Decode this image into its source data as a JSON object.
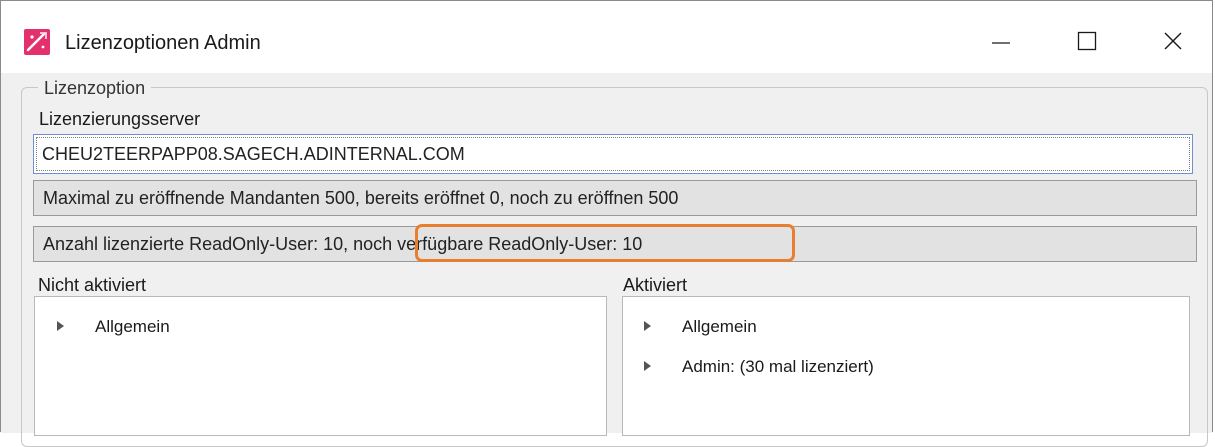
{
  "window": {
    "title": "Lizenzoptionen Admin",
    "controls": {
      "minimize": "—",
      "maximize": "☐",
      "close": "✕"
    }
  },
  "group": {
    "legend": "Lizenzoption"
  },
  "server": {
    "label": "Lizenzierungsserver",
    "value": "CHEU2TEERPAPP08.SAGECH.ADINTERNAL.COM"
  },
  "info": {
    "mandanten": "Maximal zu eröffnende Mandanten 500, bereits eröffnet 0, noch zu eröffnen 500",
    "readonly": "Anzahl lizenzierte ReadOnly-User: 10, noch verfügbare ReadOnly-User: 10"
  },
  "left_panel": {
    "label": "Nicht aktiviert",
    "items": [
      {
        "label": "Allgemein"
      }
    ]
  },
  "right_panel": {
    "label": "Aktiviert",
    "items": [
      {
        "label": "Allgemein"
      },
      {
        "label": "Admin: (30 mal lizenziert)"
      }
    ]
  },
  "colors": {
    "highlight": "#e87f2f",
    "focus_border": "#6e8fd0",
    "app_icon": "#e5306e"
  },
  "icons": {
    "app": "app-logo-icon",
    "tree_expand": "triangle-right-icon"
  }
}
